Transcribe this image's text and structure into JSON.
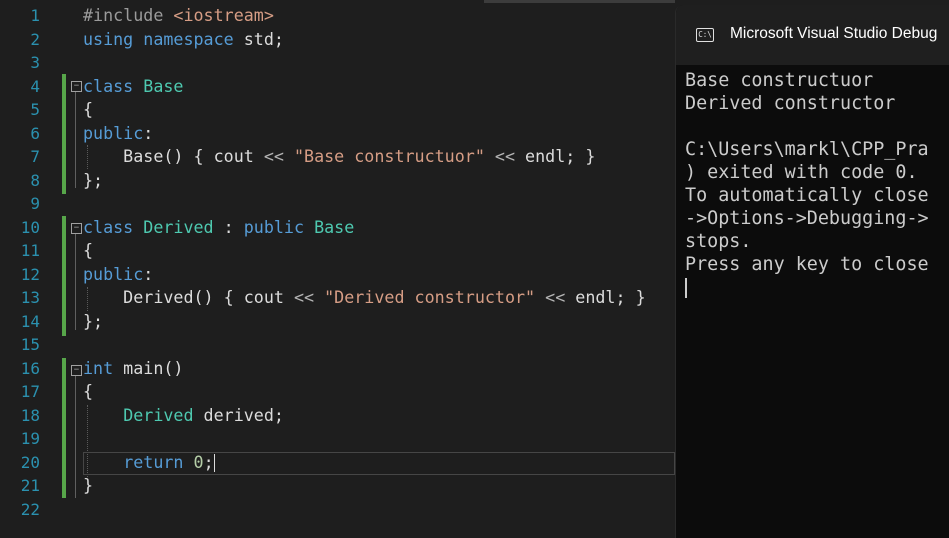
{
  "editor": {
    "line_numbers": [
      "1",
      "2",
      "3",
      "4",
      "5",
      "6",
      "7",
      "8",
      "9",
      "10",
      "11",
      "12",
      "13",
      "14",
      "15",
      "16",
      "17",
      "18",
      "19",
      "20",
      "21",
      "22"
    ],
    "lines": [
      [
        {
          "t": "#include ",
          "c": "pp"
        },
        {
          "t": "<iostream>",
          "c": "st"
        }
      ],
      [
        {
          "t": "using",
          "c": "kw"
        },
        {
          "t": " ",
          "c": ""
        },
        {
          "t": "namespace",
          "c": "kw"
        },
        {
          "t": " std;",
          "c": ""
        }
      ],
      [],
      [
        {
          "t": "class",
          "c": "kw"
        },
        {
          "t": " ",
          "c": ""
        },
        {
          "t": "Base",
          "c": "ty"
        }
      ],
      [
        {
          "t": "{",
          "c": ""
        }
      ],
      [
        {
          "t": "public",
          "c": "kw"
        },
        {
          "t": ":",
          "c": ""
        }
      ],
      [
        {
          "t": "    Base() { cout ",
          "c": ""
        },
        {
          "t": "<<",
          "c": "op"
        },
        {
          "t": " ",
          "c": ""
        },
        {
          "t": "\"Base constructuor\"",
          "c": "st"
        },
        {
          "t": " ",
          "c": ""
        },
        {
          "t": "<<",
          "c": "op"
        },
        {
          "t": " endl; }",
          "c": ""
        }
      ],
      [
        {
          "t": "};",
          "c": ""
        }
      ],
      [],
      [
        {
          "t": "class",
          "c": "kw"
        },
        {
          "t": " ",
          "c": ""
        },
        {
          "t": "Derived",
          "c": "ty"
        },
        {
          "t": " : ",
          "c": ""
        },
        {
          "t": "public",
          "c": "kw"
        },
        {
          "t": " ",
          "c": ""
        },
        {
          "t": "Base",
          "c": "ty"
        }
      ],
      [
        {
          "t": "{",
          "c": ""
        }
      ],
      [
        {
          "t": "public",
          "c": "kw"
        },
        {
          "t": ":",
          "c": ""
        }
      ],
      [
        {
          "t": "    Derived() { cout ",
          "c": ""
        },
        {
          "t": "<<",
          "c": "op"
        },
        {
          "t": " ",
          "c": ""
        },
        {
          "t": "\"Derived constructor\"",
          "c": "st"
        },
        {
          "t": " ",
          "c": ""
        },
        {
          "t": "<<",
          "c": "op"
        },
        {
          "t": " endl; }",
          "c": ""
        }
      ],
      [
        {
          "t": "};",
          "c": ""
        }
      ],
      [],
      [
        {
          "t": "int",
          "c": "kw"
        },
        {
          "t": " main()",
          "c": ""
        }
      ],
      [
        {
          "t": "{",
          "c": ""
        }
      ],
      [
        {
          "t": "    ",
          "c": ""
        },
        {
          "t": "Derived",
          "c": "ty"
        },
        {
          "t": " derived;",
          "c": ""
        }
      ],
      [],
      [
        {
          "t": "    ",
          "c": ""
        },
        {
          "t": "return",
          "c": "kw"
        },
        {
          "t": " ",
          "c": ""
        },
        {
          "t": "0",
          "c": "num"
        },
        {
          "t": ";",
          "c": ""
        }
      ],
      [
        {
          "t": "}",
          "c": ""
        }
      ],
      []
    ]
  },
  "console": {
    "title": "Microsoft Visual Studio Debug",
    "icon_text": "C:\\",
    "lines": [
      "Base constructuor",
      "Derived constructor",
      "",
      "C:\\Users\\markl\\CPP_Pra",
      ") exited with code 0.",
      "To automatically close",
      "->Options->Debugging->",
      "stops.",
      "Press any key to close"
    ]
  },
  "colors": {
    "editor_bg": "#1e1e1e",
    "keyword": "#569cd6",
    "type": "#4ec9b0",
    "string": "#d69d85",
    "line_number": "#2b91af",
    "change_bar": "#57a64a",
    "console_bg": "#0c0c0c"
  }
}
